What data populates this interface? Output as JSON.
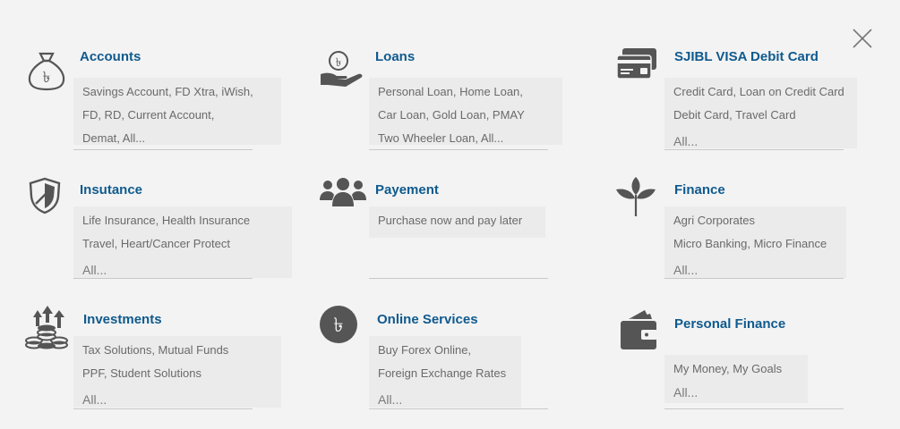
{
  "close_icon": "close-icon",
  "colors": {
    "title": "#0f5a8e",
    "icon": "#555555",
    "box_bg": "#ebebeb",
    "text": "#6a6a6a"
  },
  "cards": [
    {
      "title": "Accounts",
      "icon": "money-bag-rupee-icon",
      "lines": [
        "Savings Account, FD Xtra, iWish,",
        "FD, RD, Current Account,",
        "Demat, All..."
      ],
      "all": ""
    },
    {
      "title": "Loans",
      "icon": "hand-coin-icon",
      "lines": [
        "Personal Loan, Home Loan,",
        "Car Loan, Gold Loan, PMAY",
        "Two Wheeler Loan, All..."
      ],
      "all": ""
    },
    {
      "title": "SJIBL VISA Debit Card",
      "icon": "credit-cards-icon",
      "lines": [
        "Credit Card, Loan on Credit Card",
        "Debit Card, Travel Card"
      ],
      "all": "All..."
    },
    {
      "title": "Insutance",
      "icon": "shield-icon",
      "lines": [
        "Life Insurance, Health Insurance",
        "Travel, Heart/Cancer Protect"
      ],
      "all": "All..."
    },
    {
      "title": "Payement",
      "icon": "people-group-icon",
      "lines": [
        "Purchase now and pay later"
      ],
      "all": ""
    },
    {
      "title": "Finance",
      "icon": "plant-leaf-icon",
      "lines": [
        "Agri Corporates",
        "Micro Banking, Micro Finance"
      ],
      "all": "All..."
    },
    {
      "title": "Investments",
      "icon": "investment-coins-icon",
      "lines": [
        "Tax Solutions, Mutual Funds",
        "PPF, Student Solutions"
      ],
      "all": "All..."
    },
    {
      "title": "Online Services",
      "icon": "rupee-circle-icon",
      "lines": [
        "Buy Forex Online,",
        "Foreign Exchange Rates"
      ],
      "all": "All..."
    },
    {
      "title": "Personal Finance",
      "icon": "wallet-icon",
      "lines": [
        "My Money, My Goals"
      ],
      "all": "All..."
    }
  ]
}
